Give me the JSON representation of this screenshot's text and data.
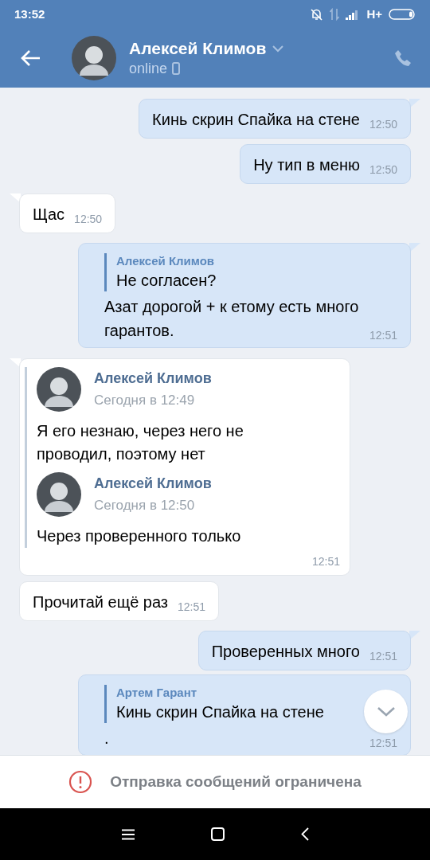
{
  "status_bar": {
    "time": "13:52",
    "network": "H+"
  },
  "header": {
    "name": "Алексей Климов",
    "status": "online"
  },
  "messages": [
    {
      "kind": "out",
      "tail": true,
      "text": "Кинь скрин Спайка на стене",
      "time": "12:50"
    },
    {
      "kind": "out",
      "tail": false,
      "text": "Ну тип в меню",
      "time": "12:50"
    },
    {
      "kind": "in",
      "tail": true,
      "text": "Щас",
      "time": "12:50"
    },
    {
      "kind": "out",
      "tail": true,
      "reply": {
        "author": "Алексей Климов",
        "text": "Не согласен?"
      },
      "text": "Азат дорогой + к етому есть много гарантов.",
      "time": "12:51"
    },
    {
      "kind": "in",
      "tail": true,
      "forwarded": [
        {
          "author": "Алексей Климов",
          "date": "Сегодня в 12:49",
          "text": "Я его незнаю, через него не проводил, поэтому нет"
        },
        {
          "author": "Алексей Климов",
          "date": "Сегодня в 12:50",
          "text": "Через проверенного только"
        }
      ],
      "time": "12:51"
    },
    {
      "kind": "in",
      "tail": false,
      "text": "Прочитай ещё раз",
      "time": "12:51"
    },
    {
      "kind": "out",
      "tail": true,
      "text": "Проверенных много",
      "time": "12:51"
    },
    {
      "kind": "out",
      "tail": false,
      "reply": {
        "author": "Артем Гарант",
        "text": "Кинь скрин Спайка на стене"
      },
      "text": ".",
      "time": "12:51"
    }
  ],
  "notice": {
    "text": "Отправка сообщений ограничена"
  }
}
